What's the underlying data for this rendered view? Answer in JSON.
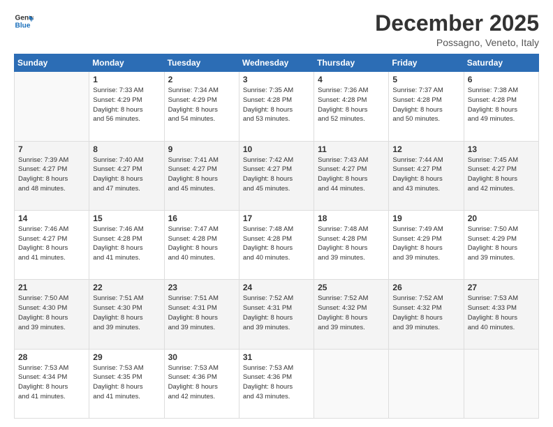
{
  "logo": {
    "line1": "General",
    "line2": "Blue"
  },
  "header": {
    "month": "December 2025",
    "location": "Possagno, Veneto, Italy"
  },
  "weekdays": [
    "Sunday",
    "Monday",
    "Tuesday",
    "Wednesday",
    "Thursday",
    "Friday",
    "Saturday"
  ],
  "weeks": [
    [
      {
        "day": "",
        "info": ""
      },
      {
        "day": "1",
        "info": "Sunrise: 7:33 AM\nSunset: 4:29 PM\nDaylight: 8 hours\nand 56 minutes."
      },
      {
        "day": "2",
        "info": "Sunrise: 7:34 AM\nSunset: 4:29 PM\nDaylight: 8 hours\nand 54 minutes."
      },
      {
        "day": "3",
        "info": "Sunrise: 7:35 AM\nSunset: 4:28 PM\nDaylight: 8 hours\nand 53 minutes."
      },
      {
        "day": "4",
        "info": "Sunrise: 7:36 AM\nSunset: 4:28 PM\nDaylight: 8 hours\nand 52 minutes."
      },
      {
        "day": "5",
        "info": "Sunrise: 7:37 AM\nSunset: 4:28 PM\nDaylight: 8 hours\nand 50 minutes."
      },
      {
        "day": "6",
        "info": "Sunrise: 7:38 AM\nSunset: 4:28 PM\nDaylight: 8 hours\nand 49 minutes."
      }
    ],
    [
      {
        "day": "7",
        "info": "Sunrise: 7:39 AM\nSunset: 4:27 PM\nDaylight: 8 hours\nand 48 minutes."
      },
      {
        "day": "8",
        "info": "Sunrise: 7:40 AM\nSunset: 4:27 PM\nDaylight: 8 hours\nand 47 minutes."
      },
      {
        "day": "9",
        "info": "Sunrise: 7:41 AM\nSunset: 4:27 PM\nDaylight: 8 hours\nand 45 minutes."
      },
      {
        "day": "10",
        "info": "Sunrise: 7:42 AM\nSunset: 4:27 PM\nDaylight: 8 hours\nand 45 minutes."
      },
      {
        "day": "11",
        "info": "Sunrise: 7:43 AM\nSunset: 4:27 PM\nDaylight: 8 hours\nand 44 minutes."
      },
      {
        "day": "12",
        "info": "Sunrise: 7:44 AM\nSunset: 4:27 PM\nDaylight: 8 hours\nand 43 minutes."
      },
      {
        "day": "13",
        "info": "Sunrise: 7:45 AM\nSunset: 4:27 PM\nDaylight: 8 hours\nand 42 minutes."
      }
    ],
    [
      {
        "day": "14",
        "info": "Sunrise: 7:46 AM\nSunset: 4:27 PM\nDaylight: 8 hours\nand 41 minutes."
      },
      {
        "day": "15",
        "info": "Sunrise: 7:46 AM\nSunset: 4:28 PM\nDaylight: 8 hours\nand 41 minutes."
      },
      {
        "day": "16",
        "info": "Sunrise: 7:47 AM\nSunset: 4:28 PM\nDaylight: 8 hours\nand 40 minutes."
      },
      {
        "day": "17",
        "info": "Sunrise: 7:48 AM\nSunset: 4:28 PM\nDaylight: 8 hours\nand 40 minutes."
      },
      {
        "day": "18",
        "info": "Sunrise: 7:48 AM\nSunset: 4:28 PM\nDaylight: 8 hours\nand 39 minutes."
      },
      {
        "day": "19",
        "info": "Sunrise: 7:49 AM\nSunset: 4:29 PM\nDaylight: 8 hours\nand 39 minutes."
      },
      {
        "day": "20",
        "info": "Sunrise: 7:50 AM\nSunset: 4:29 PM\nDaylight: 8 hours\nand 39 minutes."
      }
    ],
    [
      {
        "day": "21",
        "info": "Sunrise: 7:50 AM\nSunset: 4:30 PM\nDaylight: 8 hours\nand 39 minutes."
      },
      {
        "day": "22",
        "info": "Sunrise: 7:51 AM\nSunset: 4:30 PM\nDaylight: 8 hours\nand 39 minutes."
      },
      {
        "day": "23",
        "info": "Sunrise: 7:51 AM\nSunset: 4:31 PM\nDaylight: 8 hours\nand 39 minutes."
      },
      {
        "day": "24",
        "info": "Sunrise: 7:52 AM\nSunset: 4:31 PM\nDaylight: 8 hours\nand 39 minutes."
      },
      {
        "day": "25",
        "info": "Sunrise: 7:52 AM\nSunset: 4:32 PM\nDaylight: 8 hours\nand 39 minutes."
      },
      {
        "day": "26",
        "info": "Sunrise: 7:52 AM\nSunset: 4:32 PM\nDaylight: 8 hours\nand 39 minutes."
      },
      {
        "day": "27",
        "info": "Sunrise: 7:53 AM\nSunset: 4:33 PM\nDaylight: 8 hours\nand 40 minutes."
      }
    ],
    [
      {
        "day": "28",
        "info": "Sunrise: 7:53 AM\nSunset: 4:34 PM\nDaylight: 8 hours\nand 41 minutes."
      },
      {
        "day": "29",
        "info": "Sunrise: 7:53 AM\nSunset: 4:35 PM\nDaylight: 8 hours\nand 41 minutes."
      },
      {
        "day": "30",
        "info": "Sunrise: 7:53 AM\nSunset: 4:36 PM\nDaylight: 8 hours\nand 42 minutes."
      },
      {
        "day": "31",
        "info": "Sunrise: 7:53 AM\nSunset: 4:36 PM\nDaylight: 8 hours\nand 43 minutes."
      },
      {
        "day": "",
        "info": ""
      },
      {
        "day": "",
        "info": ""
      },
      {
        "day": "",
        "info": ""
      }
    ]
  ]
}
